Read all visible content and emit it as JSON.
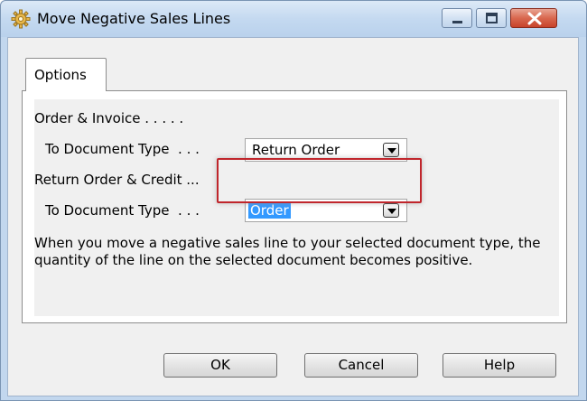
{
  "window": {
    "title": "Move Negative Sales Lines"
  },
  "tabs": [
    {
      "label": "Options"
    }
  ],
  "options": {
    "order_invoice_label": "Order & Invoice . . . . .",
    "order_invoice_doctype_label": "To Document Type  . . .",
    "order_invoice_doctype_value": "Return Order",
    "return_credit_label": "Return Order & Credit ...",
    "return_credit_doctype_label": "To Document Type  . . .",
    "return_credit_doctype_value": "Order",
    "description": "When you move a negative sales line to your selected document type, the quantity of the line on the selected document becomes positive."
  },
  "buttons": {
    "ok": "OK",
    "cancel": "Cancel",
    "help": "Help"
  },
  "colors": {
    "highlight": "#c0262c",
    "selection": "#3399ff"
  }
}
